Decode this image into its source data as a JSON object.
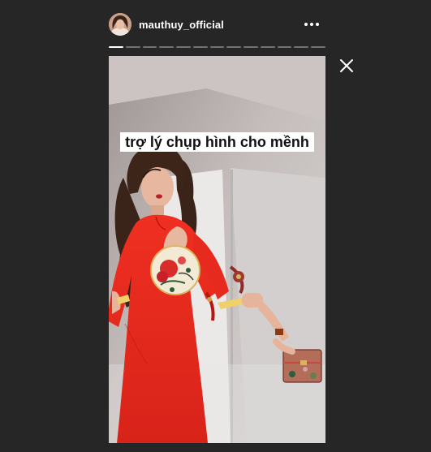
{
  "story": {
    "username": "mauthuy_official",
    "caption": "trợ lý chụp hình cho mềnh",
    "segment_count": 13,
    "active_segment": 1
  },
  "icons": {
    "more": "more-horizontal-icon",
    "close": "close-icon"
  },
  "colors": {
    "background": "#262626",
    "dress": "#e4271b",
    "caption_bg": "#ffffff"
  }
}
